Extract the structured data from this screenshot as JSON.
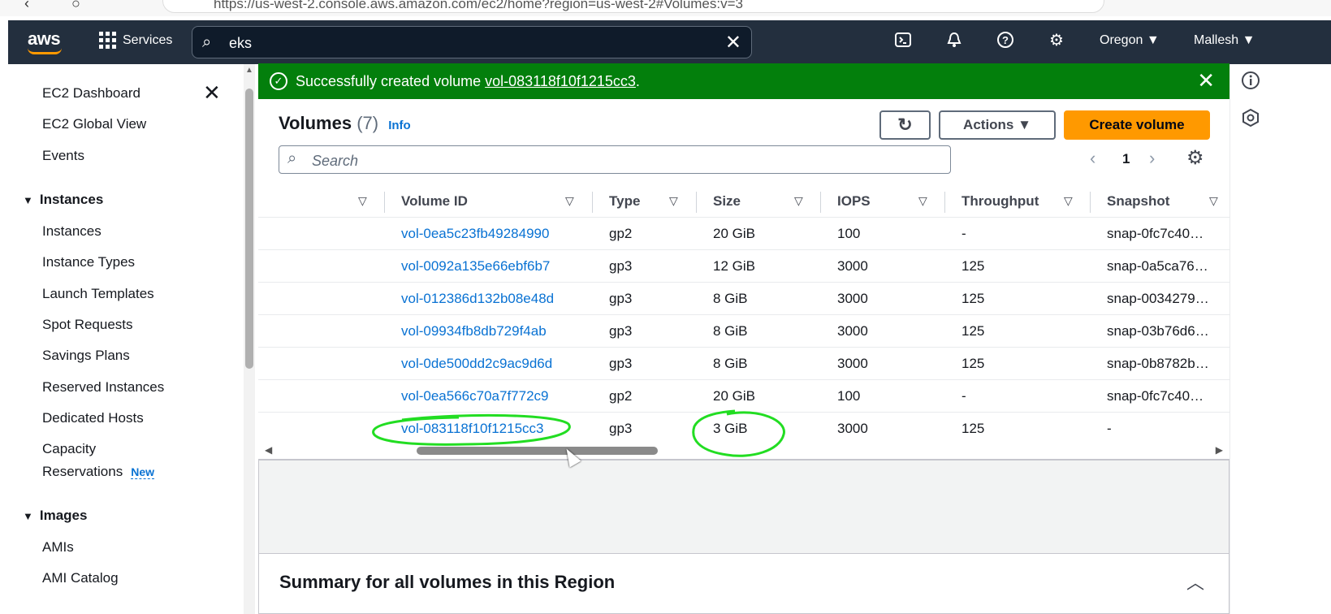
{
  "browser": {
    "url": "https://us-west-2.console.aws.amazon.com/ec2/home?region=us-west-2#Volumes:v=3"
  },
  "topnav": {
    "logo": "aws",
    "services_label": "Services",
    "search_value": "eks",
    "region": "Oregon ▼",
    "user": "Mallesh ▼"
  },
  "sidebar": {
    "top_items": [
      "EC2 Dashboard",
      "EC2 Global View",
      "Events"
    ],
    "instances_header": "Instances",
    "instances_items": [
      "Instances",
      "Instance Types",
      "Launch Templates",
      "Spot Requests",
      "Savings Plans",
      "Reserved Instances",
      "Dedicated Hosts"
    ],
    "capacity_line1": "Capacity",
    "capacity_line2": "Reservations",
    "new_badge": "New",
    "images_header": "Images",
    "images_items": [
      "AMIs",
      "AMI Catalog"
    ]
  },
  "flash": {
    "prefix": "Successfully created volume ",
    "volume_id": "vol-083118f10f1215cc3",
    "suffix": "."
  },
  "panel": {
    "title": "Volumes",
    "count": "(7)",
    "info": "Info",
    "actions_label": "Actions ▼",
    "create_label": "Create volume",
    "search_placeholder": "Search",
    "page": "1"
  },
  "table": {
    "columns": [
      "Volume ID",
      "Type",
      "Size",
      "IOPS",
      "Throughput",
      "Snapshot"
    ],
    "rows": [
      [
        "vol-0ea5c23fb49284990",
        "gp2",
        "20 GiB",
        "100",
        "-",
        "snap-0fc7c40…"
      ],
      [
        "vol-0092a135e66ebf6b7",
        "gp3",
        "12 GiB",
        "3000",
        "125",
        "snap-0a5ca76…"
      ],
      [
        "vol-012386d132b08e48d",
        "gp3",
        "8 GiB",
        "3000",
        "125",
        "snap-0034279…"
      ],
      [
        "vol-09934fb8db729f4ab",
        "gp3",
        "8 GiB",
        "3000",
        "125",
        "snap-03b76d6…"
      ],
      [
        "vol-0de500dd2c9ac9d6d",
        "gp3",
        "8 GiB",
        "3000",
        "125",
        "snap-0b8782b…"
      ],
      [
        "vol-0ea566c70a7f772c9",
        "gp2",
        "20 GiB",
        "100",
        "-",
        "snap-0fc7c40…"
      ],
      [
        "vol-083118f10f1215cc3",
        "gp3",
        "3 GiB",
        "3000",
        "125",
        "-"
      ]
    ]
  },
  "summary": {
    "title": "Summary for all volumes in this Region"
  },
  "colors": {
    "nav": "#232f3e",
    "accent": "#ff9900",
    "success": "#037f0c",
    "link": "#0972d3",
    "annotation": "#22dd22"
  }
}
